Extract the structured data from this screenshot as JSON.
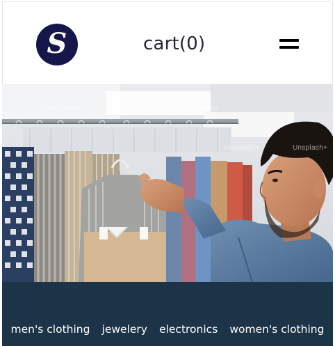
{
  "header": {
    "logo_letter": "S",
    "cart_label": "cart(0)",
    "menu_icon": "hamburger-icon"
  },
  "hero": {
    "watermark": "Unsplash+"
  },
  "categories": [
    {
      "label": "men's clothing"
    },
    {
      "label": "jewelery"
    },
    {
      "label": "electronics"
    },
    {
      "label": "women's clothing"
    }
  ],
  "colors": {
    "logo_bg": "#16164a",
    "category_bar": "#1d3348",
    "text_dark": "#26262e"
  }
}
